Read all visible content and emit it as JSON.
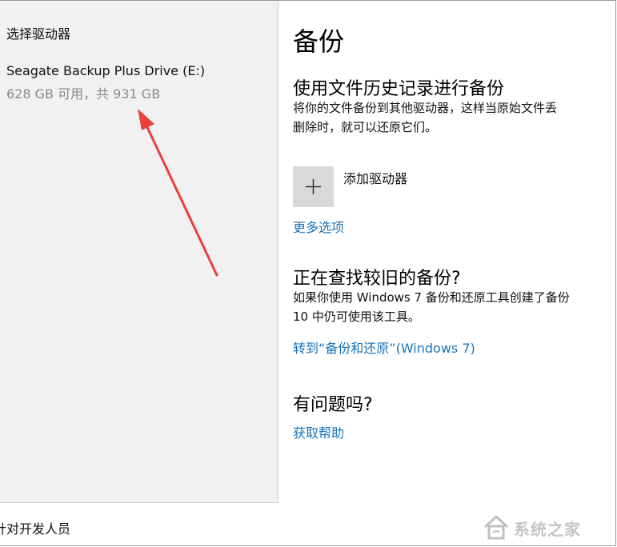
{
  "drive_panel": {
    "title": "选择驱动器",
    "drives": [
      {
        "name": "Seagate Backup Plus Drive (E:)",
        "space": "628 GB 可用，共 931 GB"
      }
    ]
  },
  "backup": {
    "page_title": "备份",
    "file_history": {
      "title": "使用文件历史记录进行备份",
      "description_line1": "将你的文件备份到其他驱动器，这样当原始文件丢",
      "description_line2": "删除时，就可以还原它们。",
      "add_drive_label": "添加驱动器",
      "more_options_link": "更多选项"
    },
    "older_backup": {
      "title": "正在查找较旧的备份?",
      "description_line1": "如果你使用 Windows 7 备份和还原工具创建了备份",
      "description_line2": "10 中仍可使用该工具。",
      "link": "转到“备份和还原”(Windows 7)"
    },
    "help": {
      "title": "有问题吗?",
      "link": "获取帮助"
    }
  },
  "sidebar": {
    "partial_item": "针对开发人员"
  },
  "watermark": {
    "text": "系统之家"
  },
  "colors": {
    "link": "#1a73b8",
    "annotation_arrow": "#e8413e",
    "panel_bg": "#f1f1f1",
    "button_bg": "#d9d9d9"
  },
  "icons": {
    "add_drive": "plus-icon",
    "annotation": "red-arrow"
  }
}
